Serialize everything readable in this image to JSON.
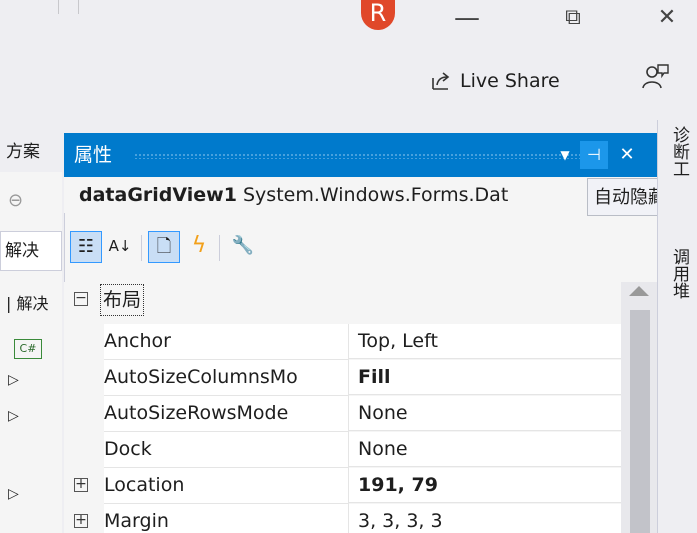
{
  "window": {
    "avatar_letter": "R",
    "minimize_glyph": "—",
    "restore_glyph": "⧉",
    "close_glyph": "✕"
  },
  "toolbar_top": {
    "live_share_label": "Live Share",
    "live_share_icon": "share-icon",
    "feedback_icon": "feedback-icon"
  },
  "left_pane": {
    "tab_label": "方案",
    "search_label": "解决",
    "tree_root_label": "解决",
    "tree_glyphs": [
      "C#",
      "▷",
      "▷",
      "",
      "▷"
    ]
  },
  "properties": {
    "title": "属性",
    "object_name": "dataGridView1",
    "object_type": "System.Windows.Forms.Dat",
    "tooltip": "自动隐藏",
    "colors": {
      "titlebar": "#007acc",
      "pin_highlight": "#1c97ea",
      "event_icon": "#f2a01a"
    },
    "category": "布局",
    "rows": [
      {
        "name": "Anchor",
        "value": "Top, Left",
        "bold": false,
        "expandable": false
      },
      {
        "name": "AutoSizeColumnsMo",
        "value": "Fill",
        "bold": true,
        "expandable": false
      },
      {
        "name": "AutoSizeRowsMode",
        "value": "None",
        "bold": false,
        "expandable": false
      },
      {
        "name": "Dock",
        "value": "None",
        "bold": false,
        "expandable": false
      },
      {
        "name": "Location",
        "value": "191, 79",
        "bold": true,
        "expandable": true
      },
      {
        "name": "Margin",
        "value": "3, 3, 3, 3",
        "bold": false,
        "expandable": true
      }
    ]
  },
  "right_tabs": [
    "诊断工",
    "调用堆"
  ]
}
